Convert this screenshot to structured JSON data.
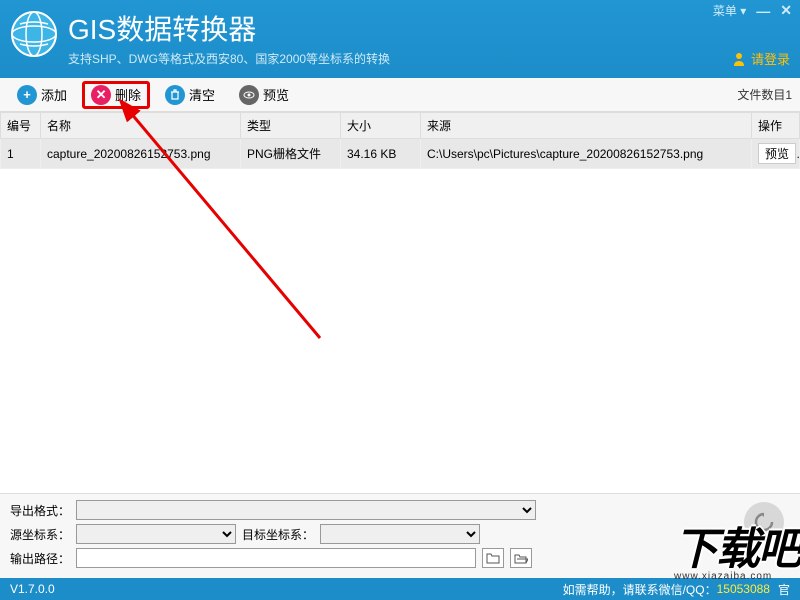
{
  "header": {
    "title": "GIS数据转换器",
    "subtitle": "支持SHP、DWG等格式及西安80、国家2000等坐标系的转换",
    "menu_label": "菜单",
    "login_label": "请登录"
  },
  "toolbar": {
    "add_label": "添加",
    "delete_label": "删除",
    "clear_label": "清空",
    "preview_label": "预览",
    "filecount_label": "文件数目1"
  },
  "table": {
    "headers": {
      "index": "编号",
      "name": "名称",
      "type": "类型",
      "size": "大小",
      "source": "来源",
      "op": "操作"
    },
    "rows": [
      {
        "index": "1",
        "name": "capture_20200826152753.png",
        "type": "PNG栅格文件",
        "size": "34.16 KB",
        "source": "C:\\Users\\pc\\Pictures\\capture_20200826152753.png",
        "op_label": "预览"
      }
    ]
  },
  "bottom": {
    "export_format_label": "导出格式：",
    "source_crs_label": "源坐标系：",
    "target_crs_label": "目标坐标系：",
    "output_path_label": "输出路径："
  },
  "statusbar": {
    "version": "V1.7.0.0",
    "help_text": "如需帮助，请联系微信/QQ：",
    "qq": "15053088",
    "tail": "官"
  },
  "watermark": {
    "big": "下载吧",
    "small": "www.xiazaiba.com"
  }
}
